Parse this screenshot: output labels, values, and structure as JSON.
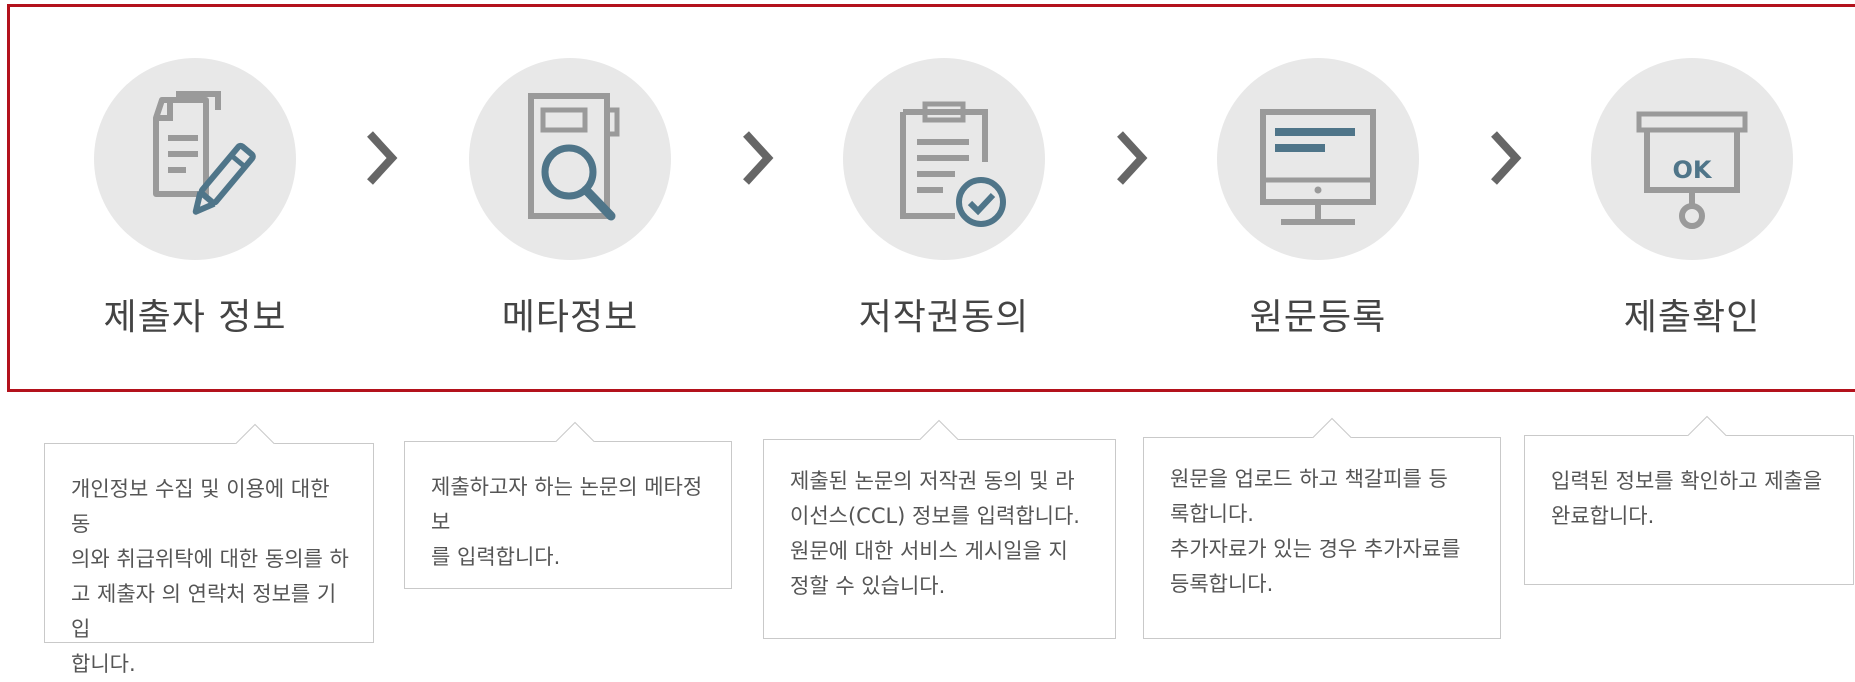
{
  "steps": [
    {
      "label": "제출자 정보",
      "icon": "document-pen-icon"
    },
    {
      "label": "메타정보",
      "icon": "document-magnifier-icon"
    },
    {
      "label": "저작권동의",
      "icon": "clipboard-check-icon"
    },
    {
      "label": "원문등록",
      "icon": "monitor-icon"
    },
    {
      "label": "제출확인",
      "icon": "ok-sign-icon"
    }
  ],
  "descriptions": [
    [
      "개인정보 수집 및 이용에 대한 동",
      "의와 취급위탁에 대한 동의를 하",
      "고 제출자 의 연락처 정보를 기입",
      "합니다."
    ],
    [
      "제출하고자 하는 논문의 메타정보",
      "를 입력합니다."
    ],
    [
      "제출된 논문의 저작권 동의 및 라",
      "이선스(CCL) 정보를 입력합니다.",
      "원문에 대한 서비스 게시일을 지",
      "정할 수 있습니다."
    ],
    [
      "원문을 업로드 하고 책갈피를 등",
      "록합니다.",
      "추가자료가 있는 경우 추가자료를",
      "등록합니다."
    ],
    [
      "입력된 정보를 확인하고 제출을",
      "완료합니다."
    ]
  ],
  "colors": {
    "frame": "#b3121c",
    "circle": "#e8e8e8",
    "icon_gray": "#9a9a9a",
    "icon_blue": "#4f7589"
  }
}
